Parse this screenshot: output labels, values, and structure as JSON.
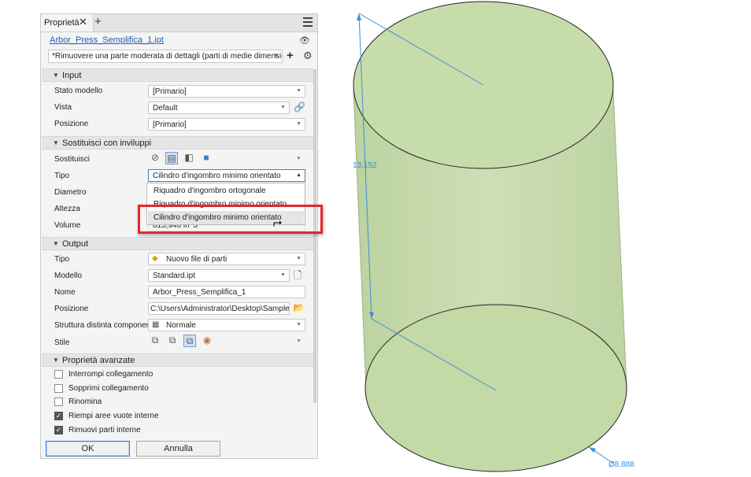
{
  "panel": {
    "tab_label": "Proprietà",
    "close_glyph": "✕",
    "add_glyph": "+",
    "file_link": "Arbor_Press_Semplifica_1.ipt",
    "preset_value": "*Rimuovere una parte moderata di dettagli (parti di medie dimensioni e",
    "sections": {
      "input": "Input",
      "envelopes": "Sostituisci con inviluppi",
      "output": "Output",
      "advanced": "Proprietà avanzate"
    },
    "input": {
      "stato_label": "Stato modello",
      "stato_value": "[Primario]",
      "vista_label": "Vista",
      "vista_value": "Default",
      "posizione_label": "Posizione",
      "posizione_value": "[Primario]"
    },
    "envelopes": {
      "sostituisci_label": "Sostituisci",
      "tipo_label": "Tipo",
      "tipo_value": "Cilindro d'ingombro minimo orientato",
      "diametro_label": "Diametro",
      "altezza_label": "Altezza",
      "volume_label": "Volume",
      "volume_value": "815,946 in^3",
      "dropdown_options": [
        "Riquadro d'ingombro ortogonale",
        "Riquadro d'ingombro minimo orientato",
        "Cilindro d'ingombro minimo orientato"
      ]
    },
    "output": {
      "tipo_label": "Tipo",
      "tipo_value": "Nuovo file di parti",
      "modello_label": "Modello",
      "modello_value": "Standard.ipt",
      "nome_label": "Nome",
      "nome_value": "Arbor_Press_Semplifica_1",
      "posizione_label": "Posizione",
      "posizione_value": "C:\\Users\\Administrator\\Desktop\\SampleFiles\\",
      "struttura_label": "Struttura distinta componenti",
      "struttura_value": "Normale",
      "stile_label": "Stile"
    },
    "advanced": [
      {
        "label": "Interrompi collegamento",
        "checked": false
      },
      {
        "label": "Sopprimi collegamento",
        "checked": false
      },
      {
        "label": "Rinomina",
        "checked": false
      },
      {
        "label": "Riempi aree vuote interne",
        "checked": true
      },
      {
        "label": "Rimuovi parti interne",
        "checked": true
      }
    ],
    "ok_label": "OK",
    "cancel_label": "Annulla"
  },
  "viewport": {
    "height_dim": "13,152",
    "diameter_dim": "Ø8,888",
    "cylinder_color": "#c9dcb0",
    "dim_color": "#3a8fd9"
  },
  "colors": {
    "highlight_box": "#e02a2a",
    "link": "#1f5fb8"
  }
}
